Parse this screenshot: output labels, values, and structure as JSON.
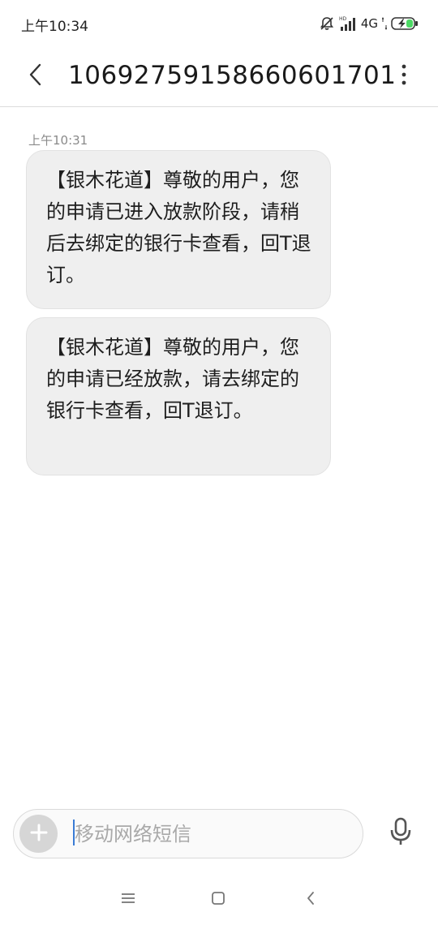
{
  "status_bar": {
    "time": "上午10:34",
    "network": "4G",
    "icons": [
      "mute-bell-icon",
      "hd-signal-icon",
      "battery-charging-icon"
    ]
  },
  "header": {
    "title": "106927591586606017​01",
    "back_icon": "chevron-left-icon",
    "more_icon": "more-vertical-icon"
  },
  "conversation": {
    "timestamp": "上午10:31",
    "messages": [
      {
        "text": "【银木花道】尊敬的用户，您的申请已进入放款阶段，请稍后去绑定的银行卡查看，回T退订。"
      },
      {
        "text": "【银木花道】尊敬的用户，您的申请已经放款，请去绑定的银行卡查看，回T退订。"
      }
    ]
  },
  "compose": {
    "placeholder": "移动网络短信",
    "value": "",
    "add_icon": "plus-icon",
    "mic_icon": "microphone-icon"
  },
  "nav_bar": {
    "icons": [
      "menu-icon",
      "home-square-icon",
      "back-chevron-icon"
    ]
  },
  "colors": {
    "bubble_bg": "#efefef",
    "caret": "#3a7bd5",
    "timestamp": "#8a8a8a"
  }
}
